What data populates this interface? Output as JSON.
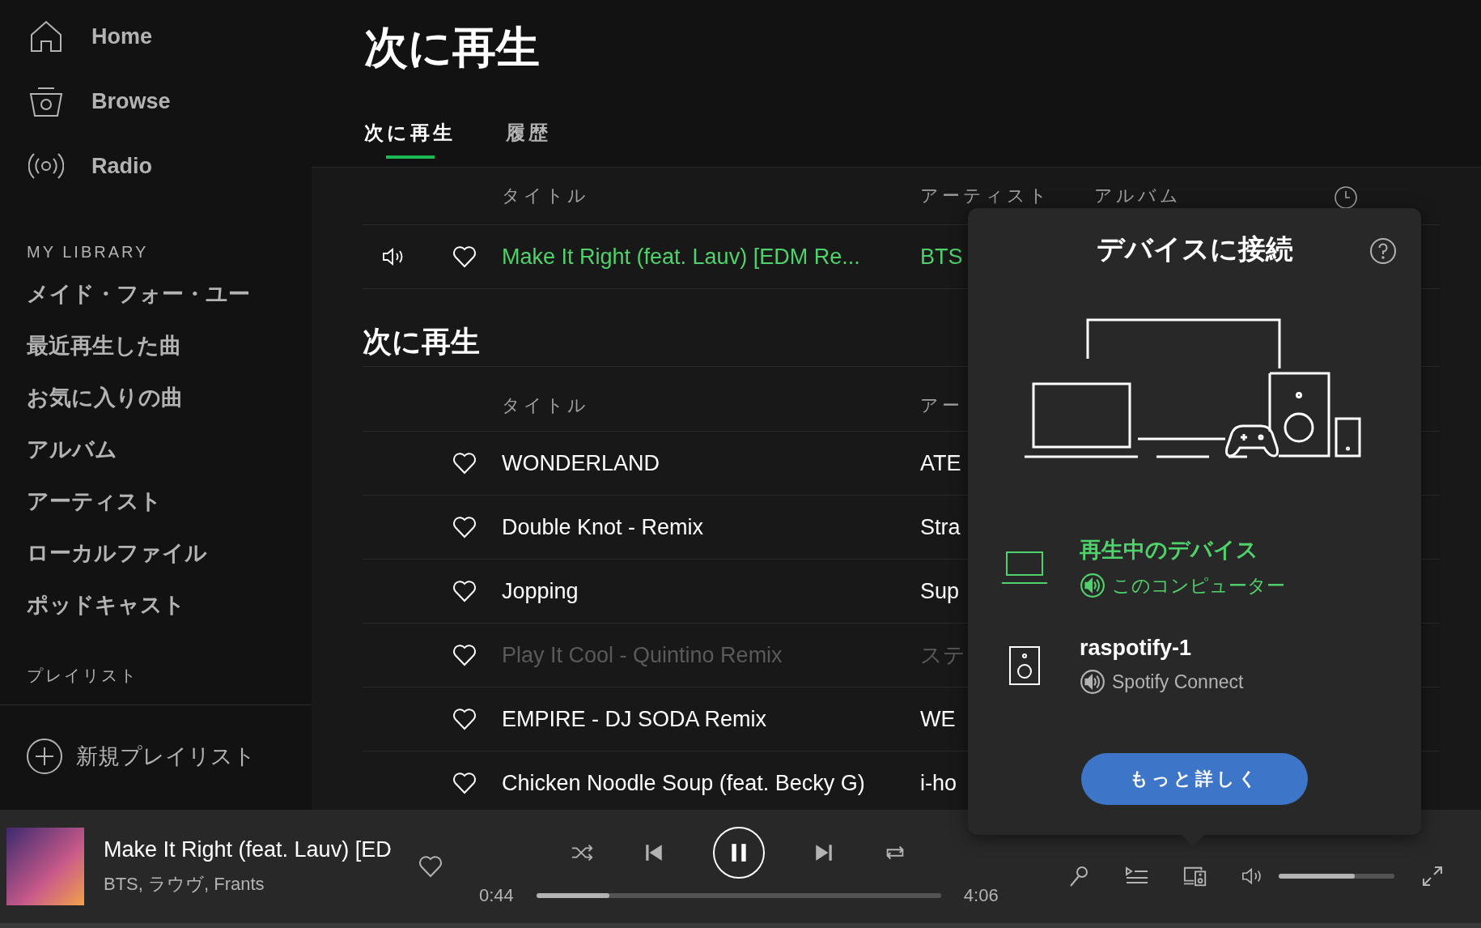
{
  "sidebar": {
    "nav": [
      {
        "label": "Home",
        "selected": false
      },
      {
        "label": "Browse",
        "selected": false
      },
      {
        "label": "Radio",
        "selected": false
      }
    ],
    "library_heading": "MY LIBRARY",
    "library": [
      "メイド・フォー・ユー",
      "最近再生した曲",
      "お気に入りの曲",
      "アルバム",
      "アーティスト",
      "ローカルファイル",
      "ポッドキャスト"
    ],
    "playlists_heading": "プレイリスト",
    "new_playlist": "新規プレイリスト"
  },
  "page": {
    "title": "次に再生",
    "tabs": [
      {
        "label": "次に再生",
        "selected": true
      },
      {
        "label": "履歴",
        "selected": false
      }
    ]
  },
  "now_playing_table": {
    "columns": [
      "タイトル",
      "アーティスト",
      "アルバム"
    ],
    "rows": [
      {
        "title": "Make It Right (feat. Lauv) [EDM Re...",
        "artist": "BTS",
        "playing": true
      }
    ]
  },
  "queue": {
    "heading": "次に再生",
    "columns": [
      "タイトル",
      "アー"
    ],
    "rows": [
      {
        "title": "WONDERLAND",
        "artist": "ATE",
        "disabled": false
      },
      {
        "title": "Double Knot - Remix",
        "artist": "Stra",
        "disabled": false
      },
      {
        "title": "Jopping",
        "artist": "Sup",
        "disabled": false
      },
      {
        "title": "Play It Cool - Quintino Remix",
        "artist": "ステ",
        "disabled": true
      },
      {
        "title": "EMPIRE - DJ SODA Remix",
        "artist": "WE",
        "disabled": false
      },
      {
        "title": "Chicken Noodle Soup (feat. Becky G)",
        "artist": "i-ho",
        "disabled": false
      }
    ]
  },
  "device_popup": {
    "title": "デバイスに接続",
    "devices": [
      {
        "kind": "computer",
        "name": "再生中のデバイス",
        "type": "このコンピューター",
        "active": true
      },
      {
        "kind": "speaker",
        "name": "raspotify-1",
        "type": "Spotify Connect",
        "active": false
      }
    ],
    "button": "もっと詳しく"
  },
  "player": {
    "title": "Make It Right (feat. Lauv) [ED",
    "artists": "BTS, ラウヴ, Frants",
    "playing": true,
    "elapsed": "0:44",
    "duration": "4:06",
    "progress": {
      "level": 0.18
    },
    "volume": {
      "level": 0.66
    }
  }
}
